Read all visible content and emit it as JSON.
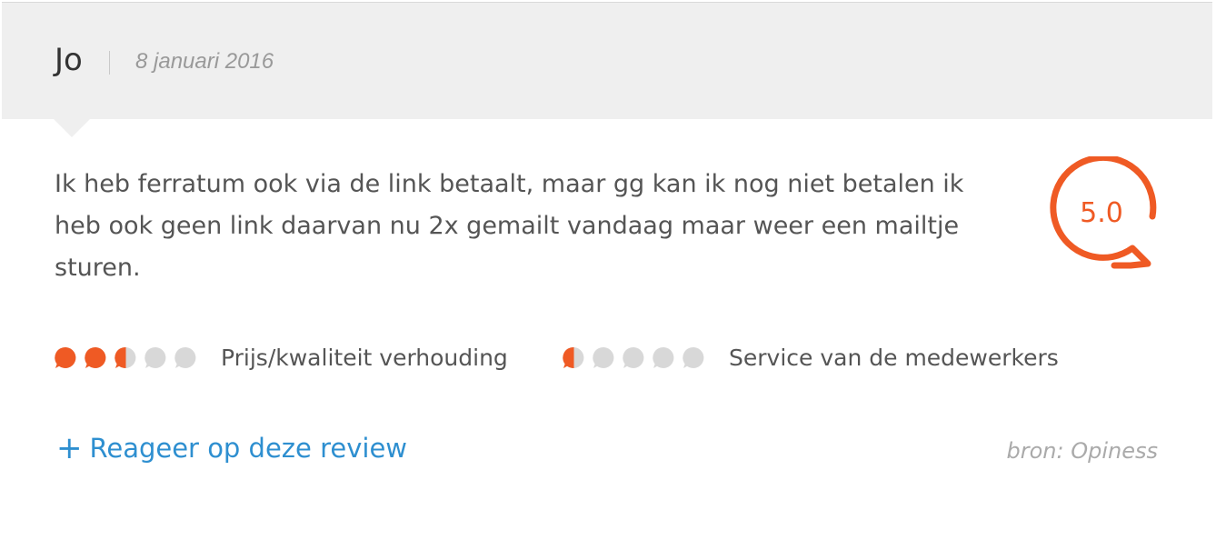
{
  "review": {
    "author": "Jo",
    "date": "8 januari 2016",
    "text": "Ik heb ferratum ook via de link betaalt, maar gg kan ik nog niet betalen ik heb ook geen link daarvan nu 2x gemailt vandaag maar weer een mailtje sturen.",
    "score": "5.0",
    "score_fraction": 1.0
  },
  "ratings": [
    {
      "label": "Prijs/kwaliteit verhouding",
      "value": 2.5,
      "max": 5
    },
    {
      "label": "Service van de medewerkers",
      "value": 0.5,
      "max": 5
    }
  ],
  "footer": {
    "reply_icon": "plus-icon",
    "reply_label": "Reageer op deze review",
    "source": "bron: Opiness"
  },
  "colors": {
    "accent": "#ef5a24",
    "dot_empty": "#d8d8d8",
    "link": "#2e8fd0",
    "header_bg": "#efefef"
  }
}
